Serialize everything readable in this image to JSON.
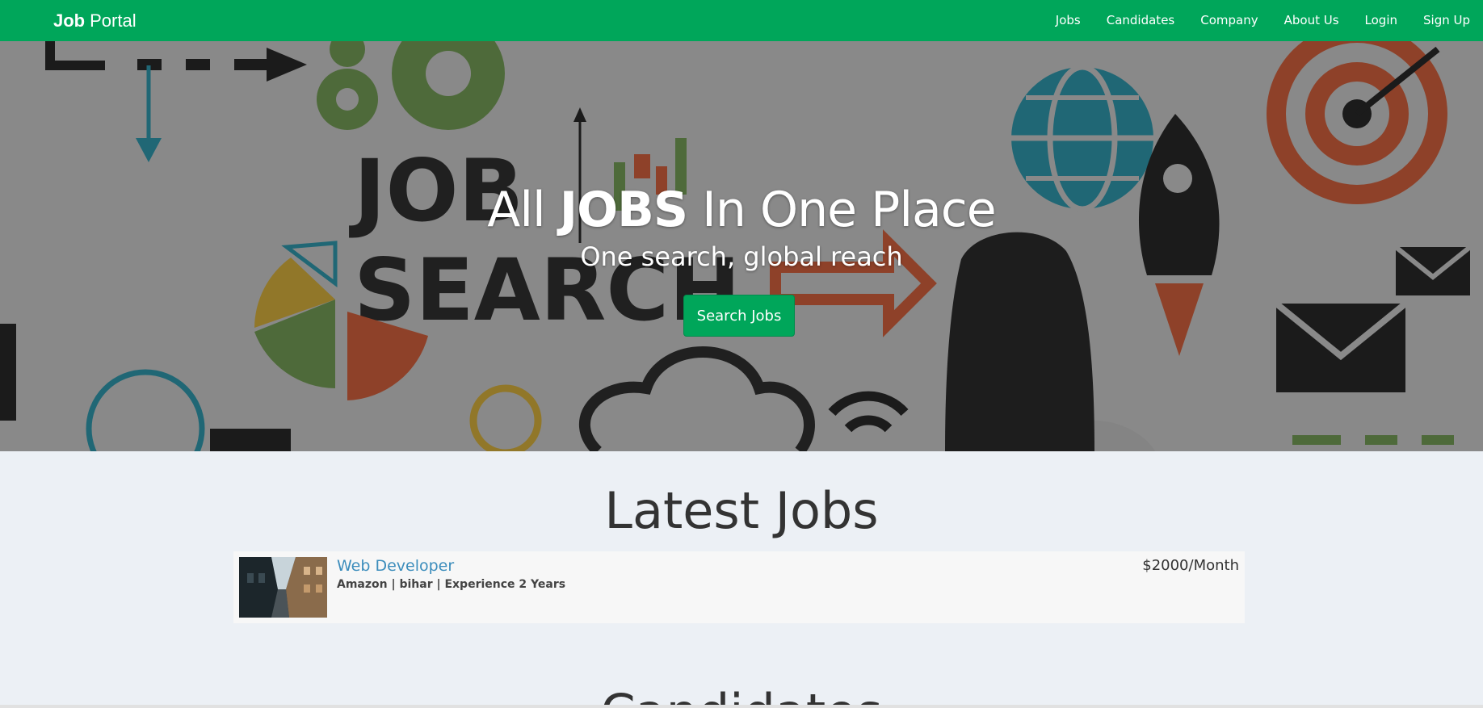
{
  "navbar": {
    "brand_bold": "Job",
    "brand_light": "Portal",
    "links": [
      "Jobs",
      "Candidates",
      "Company",
      "About Us",
      "Login",
      "Sign Up"
    ]
  },
  "hero": {
    "title_prefix": "All",
    "title_bold": "JOBS",
    "title_suffix": "In One Place",
    "subtitle": "One search, global reach",
    "button_label": "Search Jobs",
    "art_text_1": "JOB",
    "art_text_2": "SEARCH"
  },
  "latest_jobs": {
    "heading": "Latest Jobs",
    "items": [
      {
        "title": "Web Developer",
        "meta": "Amazon | bihar | Experience 2 Years",
        "salary": "$2000/Month"
      }
    ]
  },
  "candidates": {
    "heading": "Candidates"
  },
  "colors": {
    "brand_green": "#00a65a",
    "link_blue": "#3c8dbc",
    "page_bg": "#ecf0f5"
  }
}
